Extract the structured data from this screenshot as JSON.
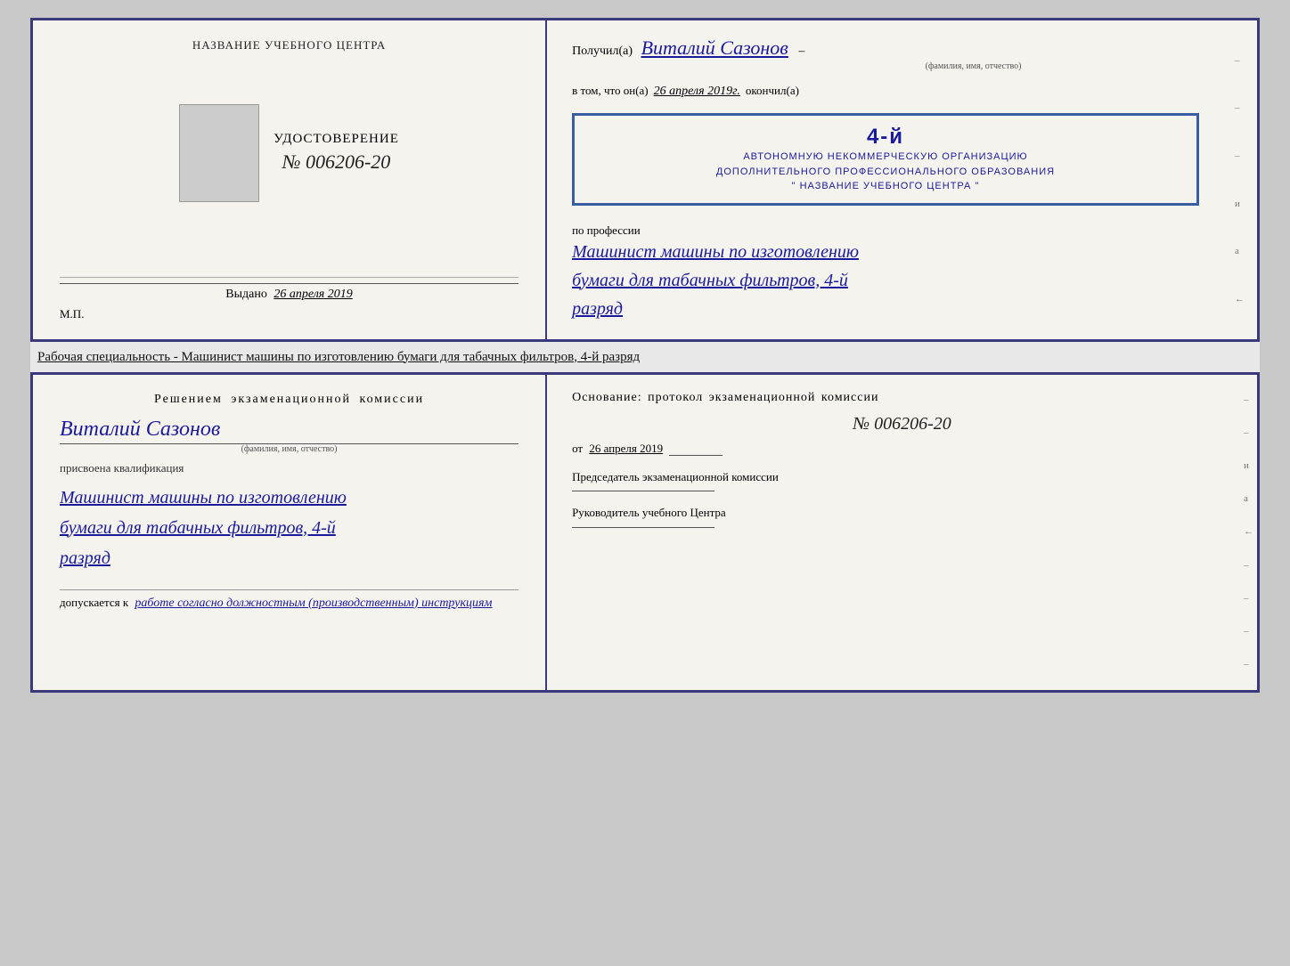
{
  "top_left": {
    "section_label": "НАЗВАНИЕ УЧЕБНОГО ЦЕНТРА",
    "cert_type": "УДОСТОВЕРЕНИЕ",
    "cert_num": "№ 006206-20",
    "vydano_label": "Выдано",
    "vydano_date": "26 апреля 2019",
    "mp_label": "М.П."
  },
  "top_right": {
    "poluchil_label": "Получил(а)",
    "recipient_name": "Виталий Сазонов",
    "fio_label": "(фамилия, имя, отчество)",
    "vtom_prefix": "в том, что он(а)",
    "vtom_date": "26 апреля 2019г.",
    "okonchil": "окончил(а)",
    "stamp_number": "4-й",
    "stamp_line1": "АВТОНОМНУЮ НЕКОММЕРЧЕСКУЮ ОРГАНИЗАЦИЮ",
    "stamp_line2": "ДОПОЛНИТЕЛЬНОГО ПРОФЕССИОНАЛЬНОГО ОБРАЗОВАНИЯ",
    "stamp_line3": "\" НАЗВАНИЕ УЧЕБНОГО ЦЕНТРА \"",
    "po_professii": "по профессии",
    "profession_line1": "Машинист машины по изготовлению",
    "profession_line2": "бумаги для табачных фильтров, 4-й",
    "profession_line3": "разряд"
  },
  "middle_text": {
    "text": "Рабочая специальность - Машинист машины по изготовлению бумаги для табачных фильтров, 4-й разряд"
  },
  "bottom_left": {
    "reshenie_title": "Решением экзаменационной комиссии",
    "name": "Виталий Сазонов",
    "fio_label": "(фамилия, имя, отчество)",
    "prisvoena_label": "присвоена квалификация",
    "kvalif_line1": "Машинист машины по изготовлению",
    "kvalif_line2": "бумаги для табачных фильтров, 4-й",
    "kvalif_line3": "разряд",
    "dopusk_prefix": "допускается к",
    "dopusk_text": "работе согласно должностным (производственным) инструкциям"
  },
  "bottom_right": {
    "osnovanie_label": "Основание: протокол экзаменационной комиссии",
    "protokol_num": "№ 006206-20",
    "ot_label": "от",
    "ot_date": "26 апреля 2019",
    "predsedatel_label": "Председатель экзаменационной комиссии",
    "rukovoditel_label": "Руководитель учебного Центра"
  },
  "side_marks": [
    "-",
    "-",
    "-",
    "и",
    "а",
    "←",
    "-",
    "-",
    "-",
    "-"
  ]
}
